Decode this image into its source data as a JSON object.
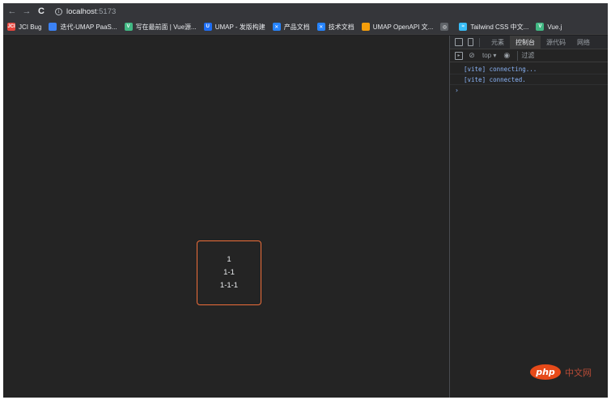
{
  "browser": {
    "url_host": "localhost",
    "url_port": ":5173",
    "icons": {
      "back": "back-arrow-icon",
      "forward": "forward-arrow-icon",
      "reload": "reload-icon",
      "info": "info-icon"
    }
  },
  "bookmarks": [
    {
      "label": "JCI Bug",
      "icon": "jci-bug-icon",
      "color": "#e8453c",
      "glyph": "JCI"
    },
    {
      "label": "迭代-UMAP PaaS...",
      "icon": "cloud-icon",
      "color": "#3b82f6",
      "glyph": ""
    },
    {
      "label": "写在最前面 | Vue源...",
      "icon": "vue-icon",
      "color": "#41b883",
      "glyph": "V"
    },
    {
      "label": "UMAP - 发版构建",
      "icon": "umap-icon",
      "color": "#1e6ef5",
      "glyph": "U"
    },
    {
      "label": "产品文档",
      "icon": "confluence-icon",
      "color": "#2684ff",
      "glyph": "✕"
    },
    {
      "label": "技术文档",
      "icon": "confluence-icon",
      "color": "#2684ff",
      "glyph": "✕"
    },
    {
      "label": "UMAP OpenAPI 文...",
      "icon": "openapi-icon",
      "color": "#f59e0b",
      "glyph": ""
    },
    {
      "label": "",
      "icon": "globe-icon",
      "color": "#5f6368",
      "glyph": "◎"
    },
    {
      "label": "Tailwind CSS 中文...",
      "icon": "tailwind-icon",
      "color": "#38bdf8",
      "glyph": "≈"
    },
    {
      "label": "Vue.j",
      "icon": "vue-icon",
      "color": "#41b883",
      "glyph": "V"
    }
  ],
  "page": {
    "lines": [
      "1",
      "1-1",
      "1-1-1"
    ],
    "border_color": "#ee6e3a"
  },
  "devtools": {
    "tabs": [
      "元素",
      "控制台",
      "源代码",
      "网络"
    ],
    "active_tab": "控制台",
    "context": "top ▾",
    "filter_placeholder": "过滤",
    "logs": [
      "[vite] connecting...",
      "[vite] connected."
    ],
    "prompt": "›"
  },
  "watermark": {
    "logo": "php",
    "text": "中文网"
  }
}
